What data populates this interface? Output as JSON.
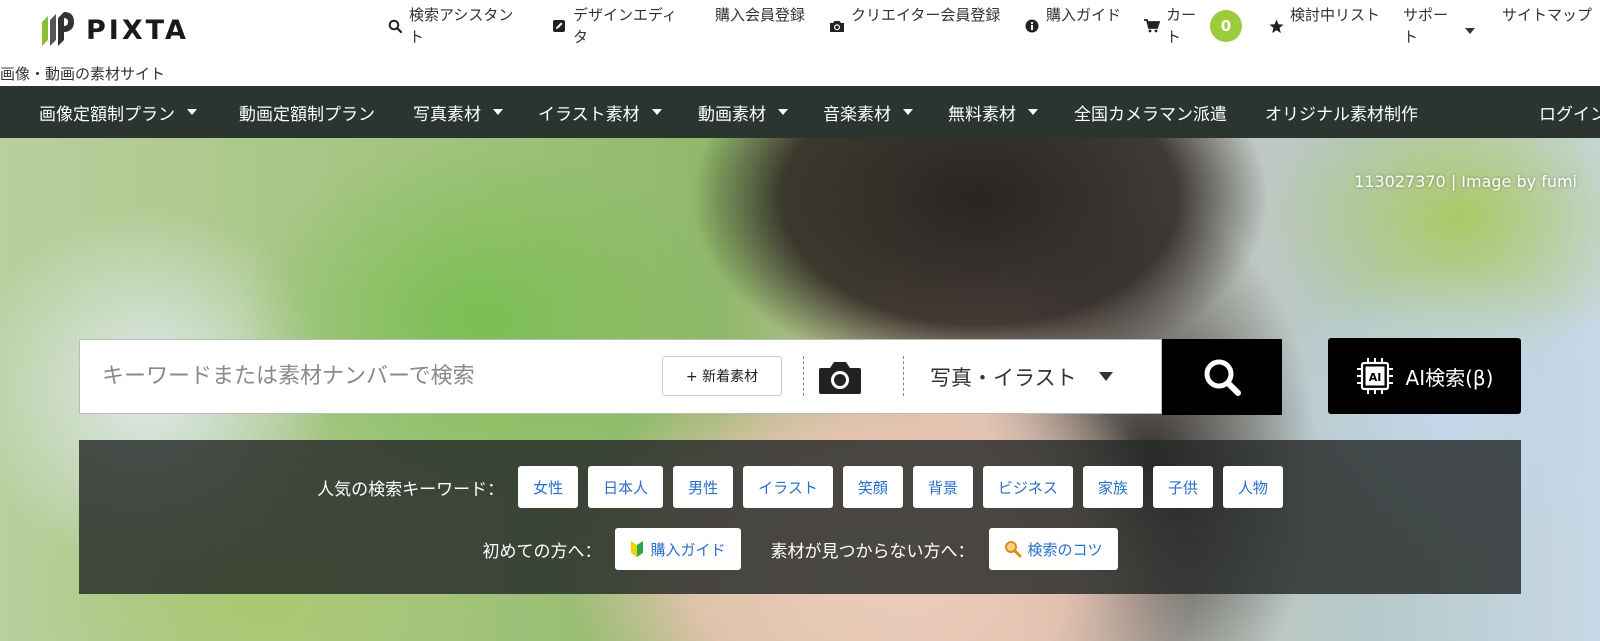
{
  "brand": {
    "logo_text": "PIXTA",
    "tagline": "画像・動画の素材サイト",
    "colors": {
      "accent_green": "#9ccc3b",
      "nav_bg": "#2b3530",
      "link_blue": "#2a6fcc"
    }
  },
  "util_nav": {
    "search_assistant": "検索アシスタント",
    "design_editor": "デザインエディタ",
    "buyer_signup": "購入会員登録",
    "creator_signup": "クリエイター会員登録",
    "purchase_guide": "購入ガイド",
    "cart": "カート",
    "cart_count": "0",
    "watchlist": "検討中リスト",
    "support": "サポート",
    "sitemap": "サイトマップ",
    "icons": [
      "search-icon",
      "edit-icon",
      "camera-icon",
      "info-icon",
      "cart-icon",
      "star-icon"
    ]
  },
  "main_nav": {
    "items": [
      {
        "label": "画像定額制プラン",
        "dropdown": true
      },
      {
        "label": "動画定額制プラン",
        "dropdown": false
      },
      {
        "label": "写真素材",
        "dropdown": true
      },
      {
        "label": "イラスト素材",
        "dropdown": true
      },
      {
        "label": "動画素材",
        "dropdown": true
      },
      {
        "label": "音楽素材",
        "dropdown": true
      },
      {
        "label": "無料素材",
        "dropdown": true
      },
      {
        "label": "全国カメラマン派遣",
        "dropdown": false
      },
      {
        "label": "オリジナル素材制作",
        "dropdown": false
      }
    ],
    "login": "ログイン"
  },
  "hero": {
    "credit": "113027370 | Image by fumi"
  },
  "search": {
    "placeholder": "キーワードまたは素材ナンバーで検索",
    "value": "",
    "new_button": "+ 新着素材",
    "type_selected": "写真・イラスト",
    "ai_button": "AI検索(β)"
  },
  "keywords": {
    "popular_label": "人気の検索キーワード：",
    "tags": [
      "女性",
      "日本人",
      "男性",
      "イラスト",
      "笑顔",
      "背景",
      "ビジネス",
      "家族",
      "子供",
      "人物"
    ],
    "first_time_label": "初めての方へ：",
    "guide_link": "購入ガイド",
    "not_found_label": "素材が見つからない方へ：",
    "tips_link": "検索のコツ"
  }
}
